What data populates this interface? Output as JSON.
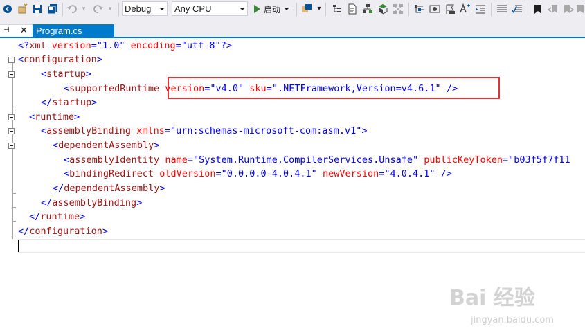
{
  "toolbar": {
    "config_value": "Debug",
    "platform_value": "Any CPU",
    "start_label": "启动",
    "icons": [
      "back-icon",
      "forward-icon",
      "new-item-icon",
      "open-file-icon",
      "save-icon",
      "save-all-icon",
      "undo-icon",
      "redo-icon",
      "start-icon",
      "nuget-icon",
      "navigate-icon",
      "solution-explorer-icon",
      "properties-icon",
      "diagram-icon",
      "class-view-icon",
      "indent-icon",
      "outdent-icon",
      "comment-icon",
      "uncomment-icon",
      "bookmark-icon",
      "prev-bookmark-icon",
      "next-bookmark-icon"
    ]
  },
  "tabs": {
    "pin_glyph": "⊣",
    "close_glyph": "✕",
    "document_label": "Program.cs"
  },
  "editor": {
    "lines": [
      "<?xml version=\"1.0\" encoding=\"utf-8\"?>",
      "<configuration>",
      "<startup>",
      "<supportedRuntime version=\"v4.0\" sku=\".NETFramework,Version=v4.6.1\" />",
      "</startup>",
      "<runtime>",
      "<assemblyBinding xmlns=\"urn:schemas-microsoft-com:asm.v1\">",
      "<dependentAssembly>",
      "<assemblyIdentity name=\"System.Runtime.CompilerServices.Unsafe\" publicKeyToken=\"b03f5f7f11",
      "<bindingRedirect oldVersion=\"0.0.0.0-4.0.4.1\" newVersion=\"4.0.4.1\" />",
      "</dependentAssembly>",
      "</assemblyBinding>",
      "</runtime>",
      "</configuration>"
    ],
    "highlight_color": "#e13438"
  },
  "watermark": {
    "brand": "Bai 经验",
    "url": "jingyan.baidu.com"
  }
}
